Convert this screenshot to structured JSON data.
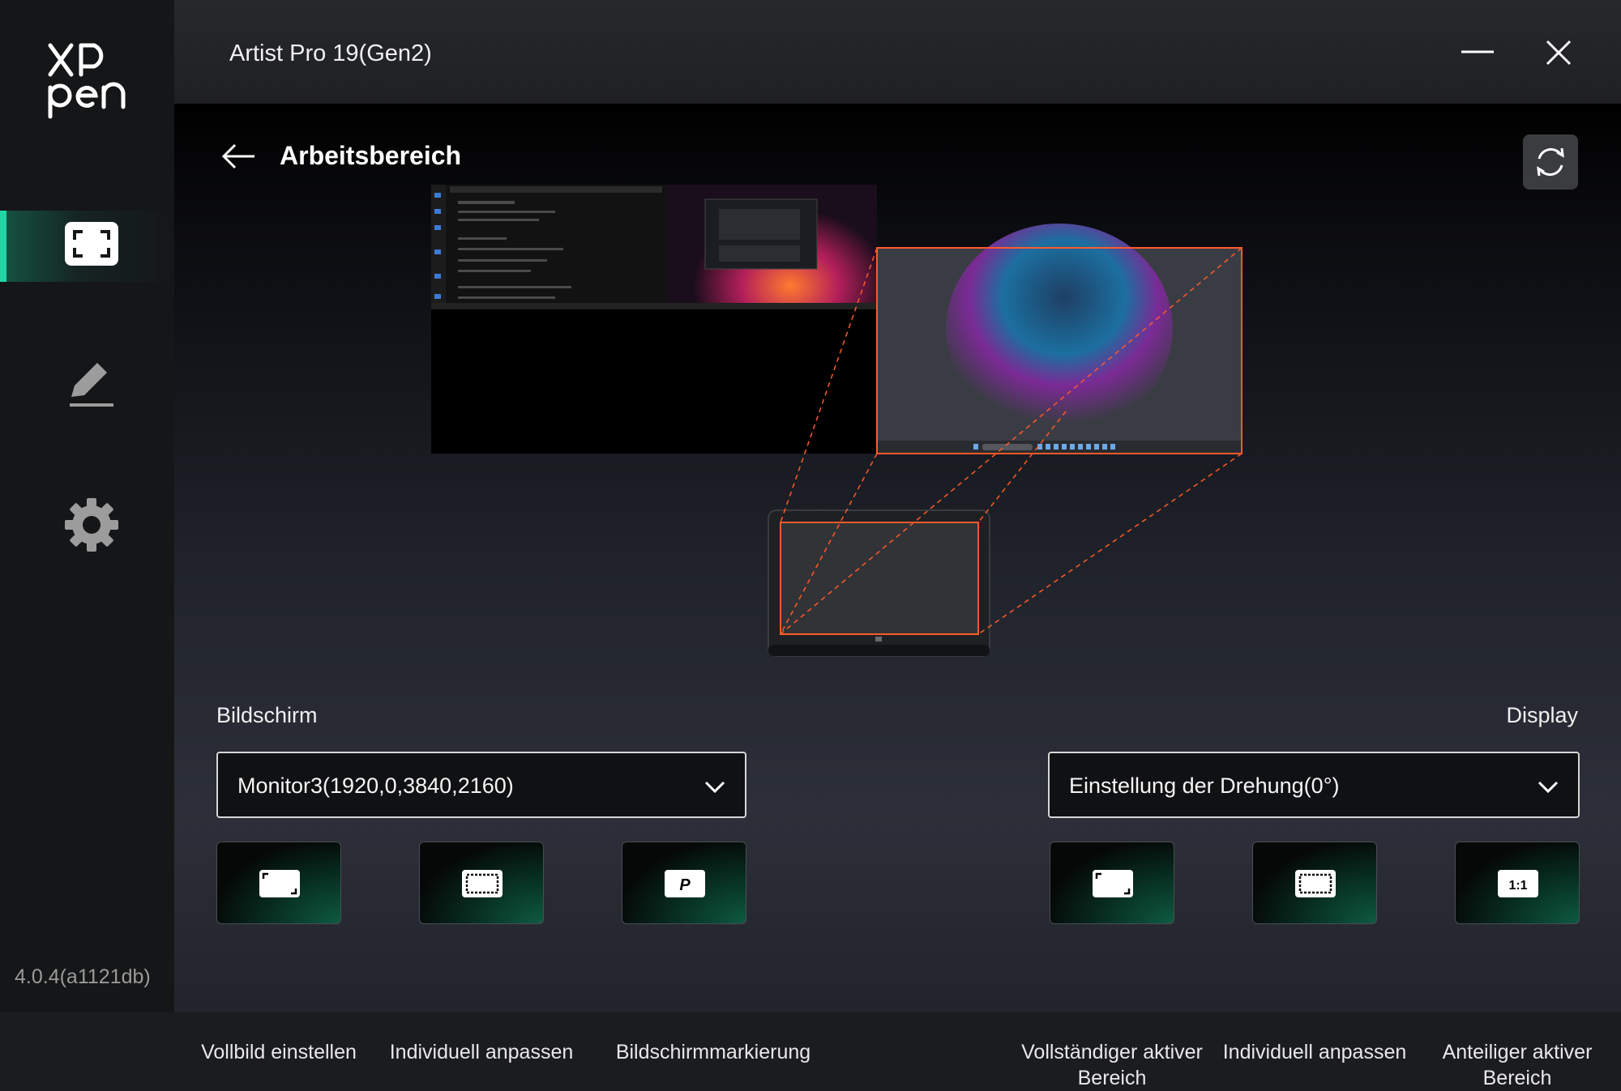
{
  "app": {
    "title": "Artist Pro 19(Gen2)",
    "version": "4.0.4(a1121db)",
    "logo_text": "XPpen",
    "accent_color": "#21d6a6",
    "highlight_color": "#ff5a2a"
  },
  "sidebar": {
    "items": [
      {
        "name": "workspace",
        "icon": "workspace-frame-icon",
        "active": true
      },
      {
        "name": "pen",
        "icon": "pen-icon",
        "active": false
      },
      {
        "name": "settings",
        "icon": "gear-icon",
        "active": false
      }
    ]
  },
  "window_controls": {
    "minimize_icon": "minimize-icon",
    "close_icon": "close-icon"
  },
  "header": {
    "title": "Arbeitsbereich",
    "back_icon": "arrow-left-icon",
    "refresh_icon": "refresh-icon"
  },
  "screen_section": {
    "label": "Bildschirm",
    "selected_monitor": "Monitor3(1920,0,3840,2160)",
    "buttons": [
      {
        "label": "Vollbild einstellen",
        "icon": "fullscreen-icon"
      },
      {
        "label": "Individuell anpassen",
        "icon": "custom-area-icon"
      },
      {
        "label": "Bildschirmmarkierung",
        "icon": "screen-mark-icon",
        "glyph": "P"
      }
    ]
  },
  "display_section": {
    "label": "Display",
    "selected_rotation": "Einstellung der Drehung(0°)",
    "buttons": [
      {
        "label": "Vollständiger aktiver Bereich",
        "icon": "full-active-area-icon"
      },
      {
        "label": "Individuell anpassen",
        "icon": "custom-area-icon"
      },
      {
        "label": "Anteiliger aktiver Bereich",
        "icon": "proportional-area-icon",
        "glyph": "1:1"
      }
    ]
  }
}
